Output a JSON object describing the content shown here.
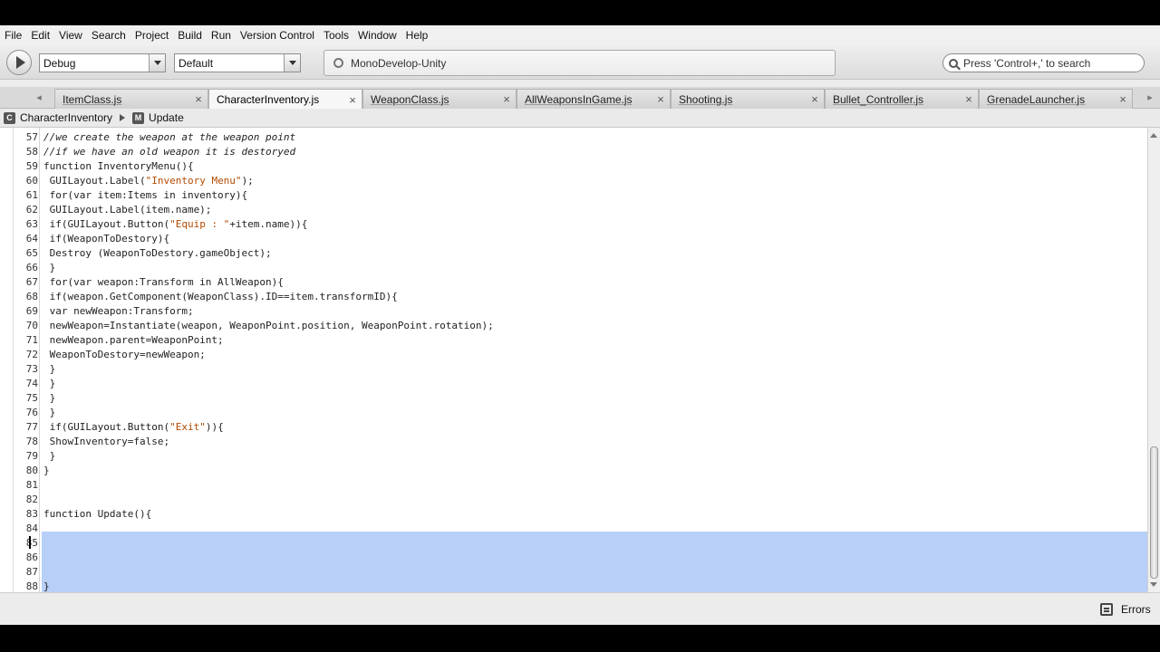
{
  "menu": [
    "File",
    "Edit",
    "View",
    "Search",
    "Project",
    "Build",
    "Run",
    "Version Control",
    "Tools",
    "Window",
    "Help"
  ],
  "toolbar": {
    "config": "Debug",
    "target": "Default",
    "status": "MonoDevelop-Unity",
    "search_placeholder": "Press 'Control+,' to search"
  },
  "tabs": [
    {
      "label": "ItemClass.js"
    },
    {
      "label": "CharacterInventory.js",
      "active": true
    },
    {
      "label": "WeaponClass.js"
    },
    {
      "label": "AllWeaponsInGame.js"
    },
    {
      "label": "Shooting.js"
    },
    {
      "label": "Bullet_Controller.js"
    },
    {
      "label": "GrenadeLauncher.js"
    }
  ],
  "tab_close_glyph": "×",
  "path": {
    "class_icon": "C",
    "class_name": "CharacterInventory",
    "member_icon": "M",
    "member_name": "Update"
  },
  "code": {
    "lines": [
      {
        "n": "57",
        "t": "//we create the weapon at the weapon point"
      },
      {
        "n": "58",
        "t": "//if we have an old weapon it is destoryed"
      },
      {
        "n": "59",
        "t": "function InventoryMenu(){"
      },
      {
        "n": "60",
        "t": " GUILayout.Label(\"Inventory Menu\");"
      },
      {
        "n": "61",
        "t": " for(var item:Items in inventory){"
      },
      {
        "n": "62",
        "t": " GUILayout.Label(item.name);"
      },
      {
        "n": "63",
        "t": " if(GUILayout.Button(\"Equip : \"+item.name)){"
      },
      {
        "n": "64",
        "t": " if(WeaponToDestory){"
      },
      {
        "n": "65",
        "t": " Destroy (WeaponToDestory.gameObject);"
      },
      {
        "n": "66",
        "t": " }"
      },
      {
        "n": "67",
        "t": " for(var weapon:Transform in AllWeapon){"
      },
      {
        "n": "68",
        "t": " if(weapon.GetComponent(WeaponClass).ID==item.transformID){"
      },
      {
        "n": "69",
        "t": " var newWeapon:Transform;"
      },
      {
        "n": "70",
        "t": " newWeapon=Instantiate(weapon, WeaponPoint.position, WeaponPoint.rotation);"
      },
      {
        "n": "71",
        "t": " newWeapon.parent=WeaponPoint;"
      },
      {
        "n": "72",
        "t": " WeaponToDestory=newWeapon;"
      },
      {
        "n": "73",
        "t": " }"
      },
      {
        "n": "74",
        "t": " }"
      },
      {
        "n": "75",
        "t": " }"
      },
      {
        "n": "76",
        "t": " }"
      },
      {
        "n": "77",
        "t": " if(GUILayout.Button(\"Exit\")){"
      },
      {
        "n": "78",
        "t": " ShowInventory=false;"
      },
      {
        "n": "79",
        "t": " }"
      },
      {
        "n": "80",
        "t": "}"
      },
      {
        "n": "81",
        "t": ""
      },
      {
        "n": "82",
        "t": ""
      },
      {
        "n": "83",
        "t": "function Update(){"
      },
      {
        "n": "84",
        "t": ""
      },
      {
        "n": "85",
        "t": ""
      },
      {
        "n": "86",
        "t": ""
      },
      {
        "n": "87",
        "t": ""
      },
      {
        "n": "88",
        "t": "}"
      }
    ],
    "selected_from_line": "83",
    "selected_to_line": "88"
  },
  "statusbar": {
    "errors_label": "Errors"
  },
  "colors": {
    "selection": "#b8cff7",
    "string": "#b34a00"
  },
  "icons": {
    "run": "play-icon",
    "status": "mono-status-icon",
    "search": "search-icon",
    "errors": "errors-list-icon"
  }
}
